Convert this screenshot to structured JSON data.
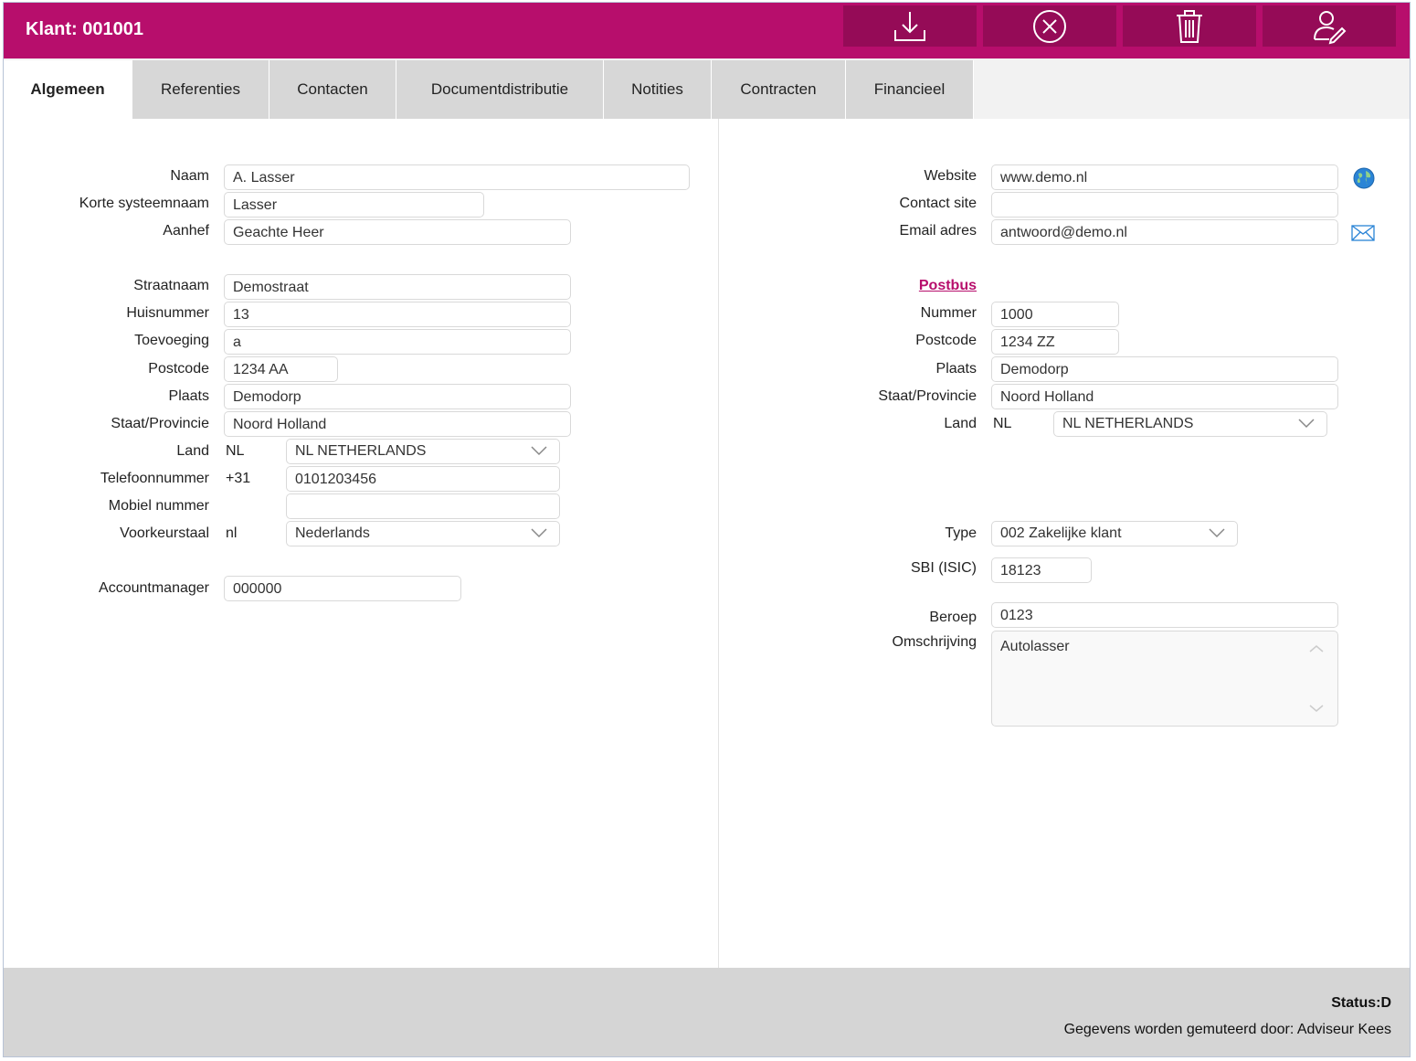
{
  "header": {
    "title": "Klant: 001001",
    "colors": {
      "bar": "#b70e6c",
      "button": "#950b57"
    },
    "buttons": [
      {
        "icon": "download-icon"
      },
      {
        "icon": "close-circle-icon"
      },
      {
        "icon": "trash-icon"
      },
      {
        "icon": "user-edit-icon"
      }
    ]
  },
  "tabs": [
    {
      "label": "Algemeen",
      "active": true
    },
    {
      "label": "Referenties"
    },
    {
      "label": "Contacten"
    },
    {
      "label": "Documentdistributie"
    },
    {
      "label": "Notities"
    },
    {
      "label": "Contracten"
    },
    {
      "label": "Financieel"
    }
  ],
  "left": {
    "naam": {
      "label": "Naam",
      "value": "A. Lasser"
    },
    "korte": {
      "label": "Korte systeemnaam",
      "value": "Lasser"
    },
    "aanhef": {
      "label": "Aanhef",
      "value": "Geachte Heer"
    },
    "straat": {
      "label": "Straatnaam",
      "value": "Demostraat"
    },
    "huisnummer": {
      "label": "Huisnummer",
      "value": "13"
    },
    "toevoeging": {
      "label": "Toevoeging",
      "value": "a"
    },
    "postcode": {
      "label": "Postcode",
      "value": "1234 AA"
    },
    "plaats": {
      "label": "Plaats",
      "value": "Demodorp"
    },
    "staat": {
      "label": "Staat/Provincie",
      "value": "Noord Holland"
    },
    "land": {
      "label": "Land",
      "code": "NL",
      "value": "NL NETHERLANDS"
    },
    "telefoon": {
      "label": "Telefoonnummer",
      "prefix": "+31",
      "value": "0101203456"
    },
    "mobiel": {
      "label": "Mobiel nummer",
      "value": ""
    },
    "taal": {
      "label": "Voorkeurstaal",
      "code": "nl",
      "value": "Nederlands"
    },
    "account": {
      "label": "Accountmanager",
      "value": "000000"
    }
  },
  "right": {
    "website": {
      "label": "Website",
      "value": "www.demo.nl",
      "icon": "globe-icon"
    },
    "contactsite": {
      "label": "Contact site",
      "value": ""
    },
    "email": {
      "label": "Email adres",
      "value": "antwoord@demo.nl",
      "icon": "mail-icon"
    },
    "postbus": {
      "label": "Postbus"
    },
    "nummer": {
      "label": "Nummer",
      "value": "1000"
    },
    "postcode": {
      "label": "Postcode",
      "value": "1234 ZZ"
    },
    "plaats": {
      "label": "Plaats",
      "value": "Demodorp"
    },
    "staat": {
      "label": "Staat/Provincie",
      "value": "Noord Holland"
    },
    "land": {
      "label": "Land",
      "code": "NL",
      "value": "NL NETHERLANDS"
    },
    "type": {
      "label": "Type",
      "value": "002 Zakelijke klant"
    },
    "sbi": {
      "label": "SBI (ISIC)",
      "value": "18123"
    },
    "beroep": {
      "label": "Beroep",
      "value": "0123"
    },
    "omschrijving": {
      "label": "Omschrijving",
      "value": "Autolasser"
    }
  },
  "footer": {
    "status": "Status:D",
    "mutated": "Gegevens worden gemuteerd door: Adviseur Kees"
  }
}
